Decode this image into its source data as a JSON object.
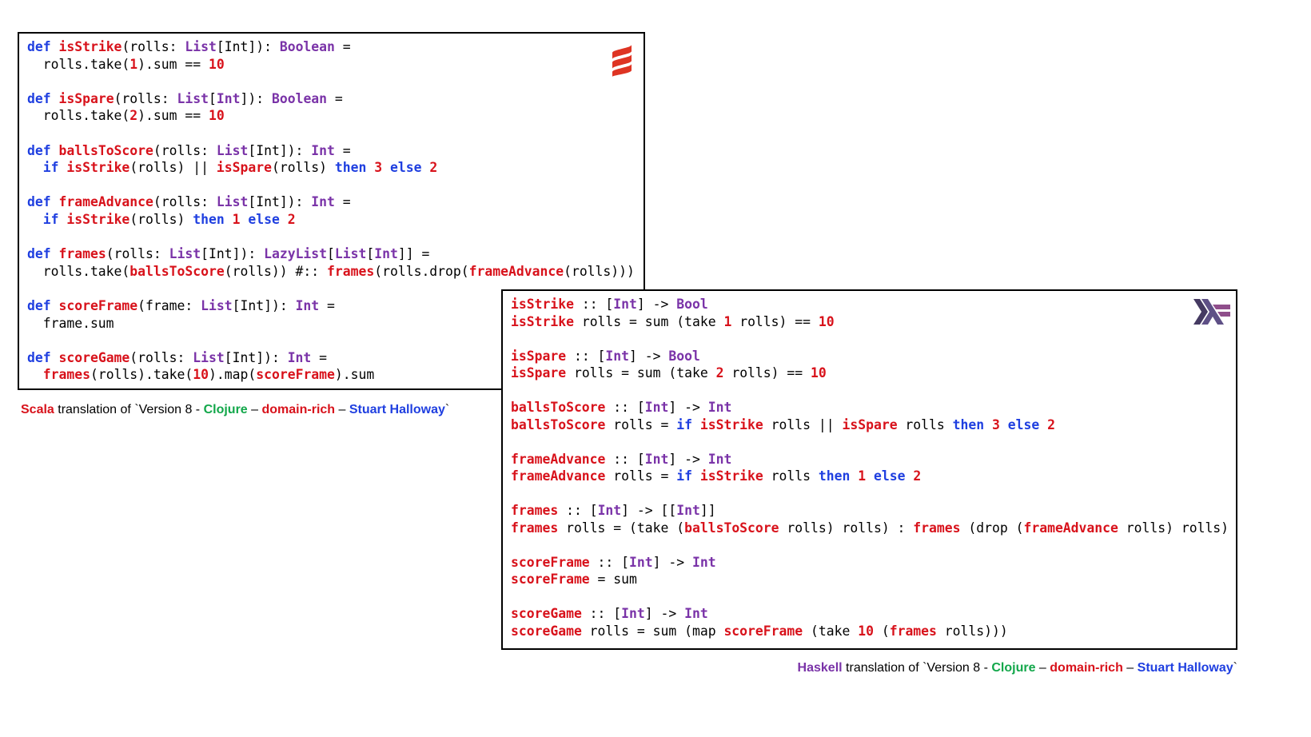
{
  "scala": {
    "logo_icon": "scala-logo-icon",
    "lines": [
      [
        [
          "def ",
          "kw"
        ],
        [
          "isStrike",
          "fn"
        ],
        [
          "(rolls: ",
          ""
        ],
        [
          "List",
          "ty"
        ],
        [
          "[Int]): ",
          ""
        ],
        [
          "Boolean",
          "ty"
        ],
        [
          " =",
          ""
        ]
      ],
      [
        [
          "  rolls.take(",
          ""
        ],
        [
          "1",
          "num"
        ],
        [
          ").sum == ",
          ""
        ],
        [
          "10",
          "num"
        ]
      ],
      [],
      [
        [
          "def ",
          "kw"
        ],
        [
          "isSpare",
          "fn"
        ],
        [
          "(rolls: ",
          ""
        ],
        [
          "List",
          "ty"
        ],
        [
          "[",
          ""
        ],
        [
          "Int",
          "ty"
        ],
        [
          "]): ",
          ""
        ],
        [
          "Boolean",
          "ty"
        ],
        [
          " =",
          ""
        ]
      ],
      [
        [
          "  rolls.take(",
          ""
        ],
        [
          "2",
          "num"
        ],
        [
          ").sum == ",
          ""
        ],
        [
          "10",
          "num"
        ]
      ],
      [],
      [
        [
          "def ",
          "kw"
        ],
        [
          "ballsToScore",
          "fn"
        ],
        [
          "(rolls: ",
          ""
        ],
        [
          "List",
          "ty"
        ],
        [
          "[Int]): ",
          ""
        ],
        [
          "Int",
          "ty"
        ],
        [
          " =",
          ""
        ]
      ],
      [
        [
          "  ",
          ""
        ],
        [
          "if ",
          "kw"
        ],
        [
          "isStrike",
          "fn"
        ],
        [
          "(rolls) || ",
          ""
        ],
        [
          "isSpare",
          "fn"
        ],
        [
          "(rolls) ",
          ""
        ],
        [
          "then ",
          "kw"
        ],
        [
          "3 ",
          "num"
        ],
        [
          "else ",
          "kw"
        ],
        [
          "2",
          "num"
        ]
      ],
      [],
      [
        [
          "def ",
          "kw"
        ],
        [
          "frameAdvance",
          "fn"
        ],
        [
          "(rolls: ",
          ""
        ],
        [
          "List",
          "ty"
        ],
        [
          "[Int]): ",
          ""
        ],
        [
          "Int",
          "ty"
        ],
        [
          " =",
          ""
        ]
      ],
      [
        [
          "  ",
          ""
        ],
        [
          "if ",
          "kw"
        ],
        [
          "isStrike",
          "fn"
        ],
        [
          "(rolls) ",
          ""
        ],
        [
          "then ",
          "kw"
        ],
        [
          "1 ",
          "num"
        ],
        [
          "else ",
          "kw"
        ],
        [
          "2",
          "num"
        ]
      ],
      [],
      [
        [
          "def ",
          "kw"
        ],
        [
          "frames",
          "fn"
        ],
        [
          "(rolls: ",
          ""
        ],
        [
          "List",
          "ty"
        ],
        [
          "[Int]): ",
          ""
        ],
        [
          "LazyList",
          "ty"
        ],
        [
          "[",
          ""
        ],
        [
          "List",
          "ty"
        ],
        [
          "[",
          ""
        ],
        [
          "Int",
          "ty"
        ],
        [
          "]] =",
          ""
        ]
      ],
      [
        [
          "  rolls.take(",
          ""
        ],
        [
          "ballsToScore",
          "fn"
        ],
        [
          "(rolls)) #:: ",
          ""
        ],
        [
          "frames",
          "fn"
        ],
        [
          "(rolls.drop(",
          ""
        ],
        [
          "frameAdvance",
          "fn"
        ],
        [
          "(rolls)))",
          ""
        ]
      ],
      [],
      [
        [
          "def ",
          "kw"
        ],
        [
          "scoreFrame",
          "fn"
        ],
        [
          "(frame: ",
          ""
        ],
        [
          "List",
          "ty"
        ],
        [
          "[Int]): ",
          ""
        ],
        [
          "Int",
          "ty"
        ],
        [
          " =",
          ""
        ]
      ],
      [
        [
          "  frame.sum",
          ""
        ]
      ],
      [],
      [
        [
          "def ",
          "kw"
        ],
        [
          "scoreGame",
          "fn"
        ],
        [
          "(rolls: ",
          ""
        ],
        [
          "List",
          "ty"
        ],
        [
          "[Int]): ",
          ""
        ],
        [
          "Int",
          "ty"
        ],
        [
          " =",
          ""
        ]
      ],
      [
        [
          "  ",
          ""
        ],
        [
          "frames",
          "fn"
        ],
        [
          "(rolls).take(",
          ""
        ],
        [
          "10",
          "num"
        ],
        [
          ").map(",
          ""
        ],
        [
          "scoreFrame",
          "fn"
        ],
        [
          ").sum",
          ""
        ]
      ]
    ],
    "caption": {
      "lang": "Scala",
      "text1": " translation of `Version 8 - ",
      "clojure": "Clojure",
      "dash1": " – ",
      "domain_rich": "domain-rich",
      "dash2": " – ",
      "author": "Stuart Halloway",
      "end": "`"
    }
  },
  "haskell": {
    "logo_icon": "haskell-logo-icon",
    "lines": [
      [
        [
          "isStrike",
          "fn"
        ],
        [
          " :: [",
          ""
        ],
        [
          "Int",
          "ty"
        ],
        [
          "] -> ",
          ""
        ],
        [
          "Bool",
          "ty"
        ]
      ],
      [
        [
          "isStrike",
          "fn"
        ],
        [
          " rolls = sum (take ",
          ""
        ],
        [
          "1",
          "num"
        ],
        [
          " rolls) == ",
          ""
        ],
        [
          "10",
          "num"
        ]
      ],
      [],
      [
        [
          "isSpare",
          "fn"
        ],
        [
          " :: [",
          ""
        ],
        [
          "Int",
          "ty"
        ],
        [
          "] -> ",
          ""
        ],
        [
          "Bool",
          "ty"
        ]
      ],
      [
        [
          "isSpare",
          "fn"
        ],
        [
          " rolls = sum (take ",
          ""
        ],
        [
          "2",
          "num"
        ],
        [
          " rolls) == ",
          ""
        ],
        [
          "10",
          "num"
        ]
      ],
      [],
      [
        [
          "ballsToScore",
          "fn"
        ],
        [
          " :: [",
          ""
        ],
        [
          "Int",
          "ty"
        ],
        [
          "] -> ",
          ""
        ],
        [
          "Int",
          "ty"
        ]
      ],
      [
        [
          "ballsToScore",
          "fn"
        ],
        [
          " rolls = ",
          ""
        ],
        [
          "if ",
          "kw"
        ],
        [
          "isStrike",
          "fn"
        ],
        [
          " rolls || ",
          ""
        ],
        [
          "isSpare",
          "fn"
        ],
        [
          " rolls ",
          ""
        ],
        [
          "then ",
          "kw"
        ],
        [
          "3 ",
          "num"
        ],
        [
          "else ",
          "kw"
        ],
        [
          "2",
          "num"
        ]
      ],
      [],
      [
        [
          "frameAdvance",
          "fn"
        ],
        [
          " :: [",
          ""
        ],
        [
          "Int",
          "ty"
        ],
        [
          "] -> ",
          ""
        ],
        [
          "Int",
          "ty"
        ]
      ],
      [
        [
          "frameAdvance",
          "fn"
        ],
        [
          " rolls = ",
          ""
        ],
        [
          "if ",
          "kw"
        ],
        [
          "isStrike",
          "fn"
        ],
        [
          " rolls ",
          ""
        ],
        [
          "then ",
          "kw"
        ],
        [
          "1 ",
          "num"
        ],
        [
          "else ",
          "kw"
        ],
        [
          "2",
          "num"
        ]
      ],
      [],
      [
        [
          "frames",
          "fn"
        ],
        [
          " :: [",
          ""
        ],
        [
          "Int",
          "ty"
        ],
        [
          "] -> [[",
          ""
        ],
        [
          "Int",
          "ty"
        ],
        [
          "]]",
          ""
        ]
      ],
      [
        [
          "frames",
          "fn"
        ],
        [
          " rolls = (take (",
          ""
        ],
        [
          "ballsToScore",
          "fn"
        ],
        [
          " rolls) rolls) : ",
          ""
        ],
        [
          "frames",
          "fn"
        ],
        [
          " (drop (",
          ""
        ],
        [
          "frameAdvance",
          "fn"
        ],
        [
          " rolls) rolls)",
          ""
        ]
      ],
      [],
      [
        [
          "scoreFrame",
          "fn"
        ],
        [
          " :: [",
          ""
        ],
        [
          "Int",
          "ty"
        ],
        [
          "] -> ",
          ""
        ],
        [
          "Int",
          "ty"
        ]
      ],
      [
        [
          "scoreFrame",
          "fn"
        ],
        [
          " = sum",
          ""
        ]
      ],
      [],
      [
        [
          "scoreGame",
          "fn"
        ],
        [
          " :: [",
          ""
        ],
        [
          "Int",
          "ty"
        ],
        [
          "] -> ",
          ""
        ],
        [
          "Int",
          "ty"
        ]
      ],
      [
        [
          "scoreGame",
          "fn"
        ],
        [
          " rolls = sum (map ",
          ""
        ],
        [
          "scoreFrame",
          "fn"
        ],
        [
          " (take ",
          ""
        ],
        [
          "10",
          "num"
        ],
        [
          " (",
          ""
        ],
        [
          "frames",
          "fn"
        ],
        [
          " rolls)))",
          ""
        ]
      ]
    ],
    "caption": {
      "lang": "Haskell",
      "text1": " translation of `Version 8 - ",
      "clojure": "Clojure",
      "dash1": " – ",
      "domain_rich": "domain-rich",
      "dash2": " – ",
      "author": "Stuart Halloway",
      "end": "`"
    }
  },
  "colors": {
    "keyword": "#1f3fe0",
    "function": "#d8121b",
    "type": "#7a33a8",
    "number": "#d8121b",
    "clojure": "#12a74a"
  }
}
